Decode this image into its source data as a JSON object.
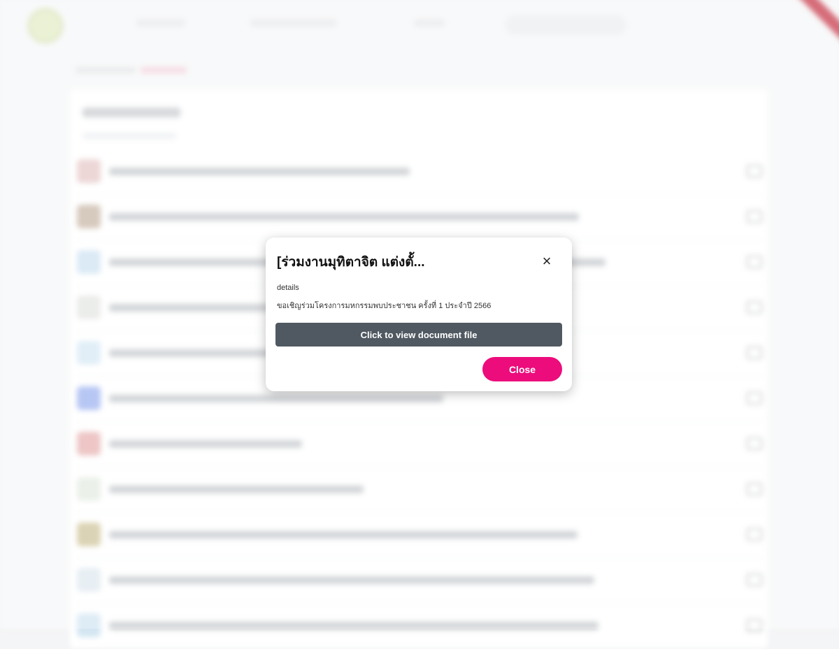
{
  "background": {
    "nav": [],
    "breadcrumb": [],
    "card": {
      "title": "",
      "subtitle": ""
    },
    "rows": [
      {
        "thumb_color": "#e7c9c9"
      },
      {
        "thumb_color": "#c9b8a8"
      },
      {
        "thumb_color": "#cfe3f2"
      },
      {
        "thumb_color": "#e5e7e3"
      },
      {
        "thumb_color": "#d7e9f5"
      },
      {
        "thumb_color": "#9fb4f0"
      },
      {
        "thumb_color": "#e8b3b3"
      },
      {
        "thumb_color": "#e4ece2"
      },
      {
        "thumb_color": "#cfc59c"
      },
      {
        "thumb_color": "#dfe9f0"
      },
      {
        "thumb_color": "#d3e6f2"
      }
    ]
  },
  "modal": {
    "title": "[ร่วมงานมุทิตาจิต แต่งตั้...",
    "close_icon": "×",
    "details_label": "details",
    "details_text": "ขอเชิญร่วมโครงการมหกรรมพบประชาชน ครั้งที่ 1 ประจำปี 2566",
    "view_button_label": "Click to view document file",
    "close_button_label": "Close"
  },
  "colors": {
    "view_button": "#505961",
    "close_button": "#ec0c7c"
  }
}
